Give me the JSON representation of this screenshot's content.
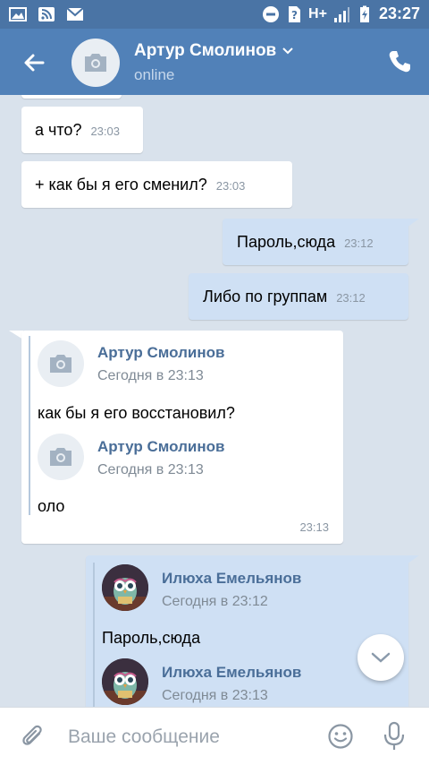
{
  "status_bar": {
    "time": "23:27",
    "network": "H+"
  },
  "header": {
    "contact_name": "Артур Смолинов",
    "contact_status": "online",
    "icons": [
      "back-arrow-icon",
      "camera-icon",
      "chevron-down-icon",
      "phone-icon"
    ]
  },
  "messages": [
    {
      "direction": "in",
      "text": "а что?",
      "time": "23:03"
    },
    {
      "direction": "in",
      "text": "+ как бы я его сменил?",
      "time": "23:03"
    },
    {
      "direction": "out",
      "text": "Пароль,сюда",
      "time": "23:12"
    },
    {
      "direction": "out",
      "text": "Либо по группам",
      "time": "23:12"
    }
  ],
  "forwarded_in": {
    "time": "23:13",
    "items": [
      {
        "author": "Артур Смолинов",
        "date": "Сегодня в 23:13",
        "text": "как бы я его восстановил?"
      },
      {
        "author": "Артур Смолинов",
        "date": "Сегодня в 23:13",
        "text": "оло"
      }
    ]
  },
  "forwarded_out": {
    "items": [
      {
        "author": "Илюха Емельянов",
        "date": "Сегодня в 23:12",
        "text": "Пароль,сюда"
      },
      {
        "author": "Илюха Емельянов",
        "date": "Сегодня в 23:13",
        "text": ""
      }
    ]
  },
  "composer": {
    "placeholder": "Ваше сообщение",
    "value": ""
  },
  "colors": {
    "header_bg": "#5181b8",
    "statusbar_bg": "#4a74a5",
    "chat_bg": "#d9e2ec",
    "outgoing_bubble": "#cfe0f4",
    "incoming_bubble": "#ffffff",
    "author_name": "#4a6e98"
  }
}
